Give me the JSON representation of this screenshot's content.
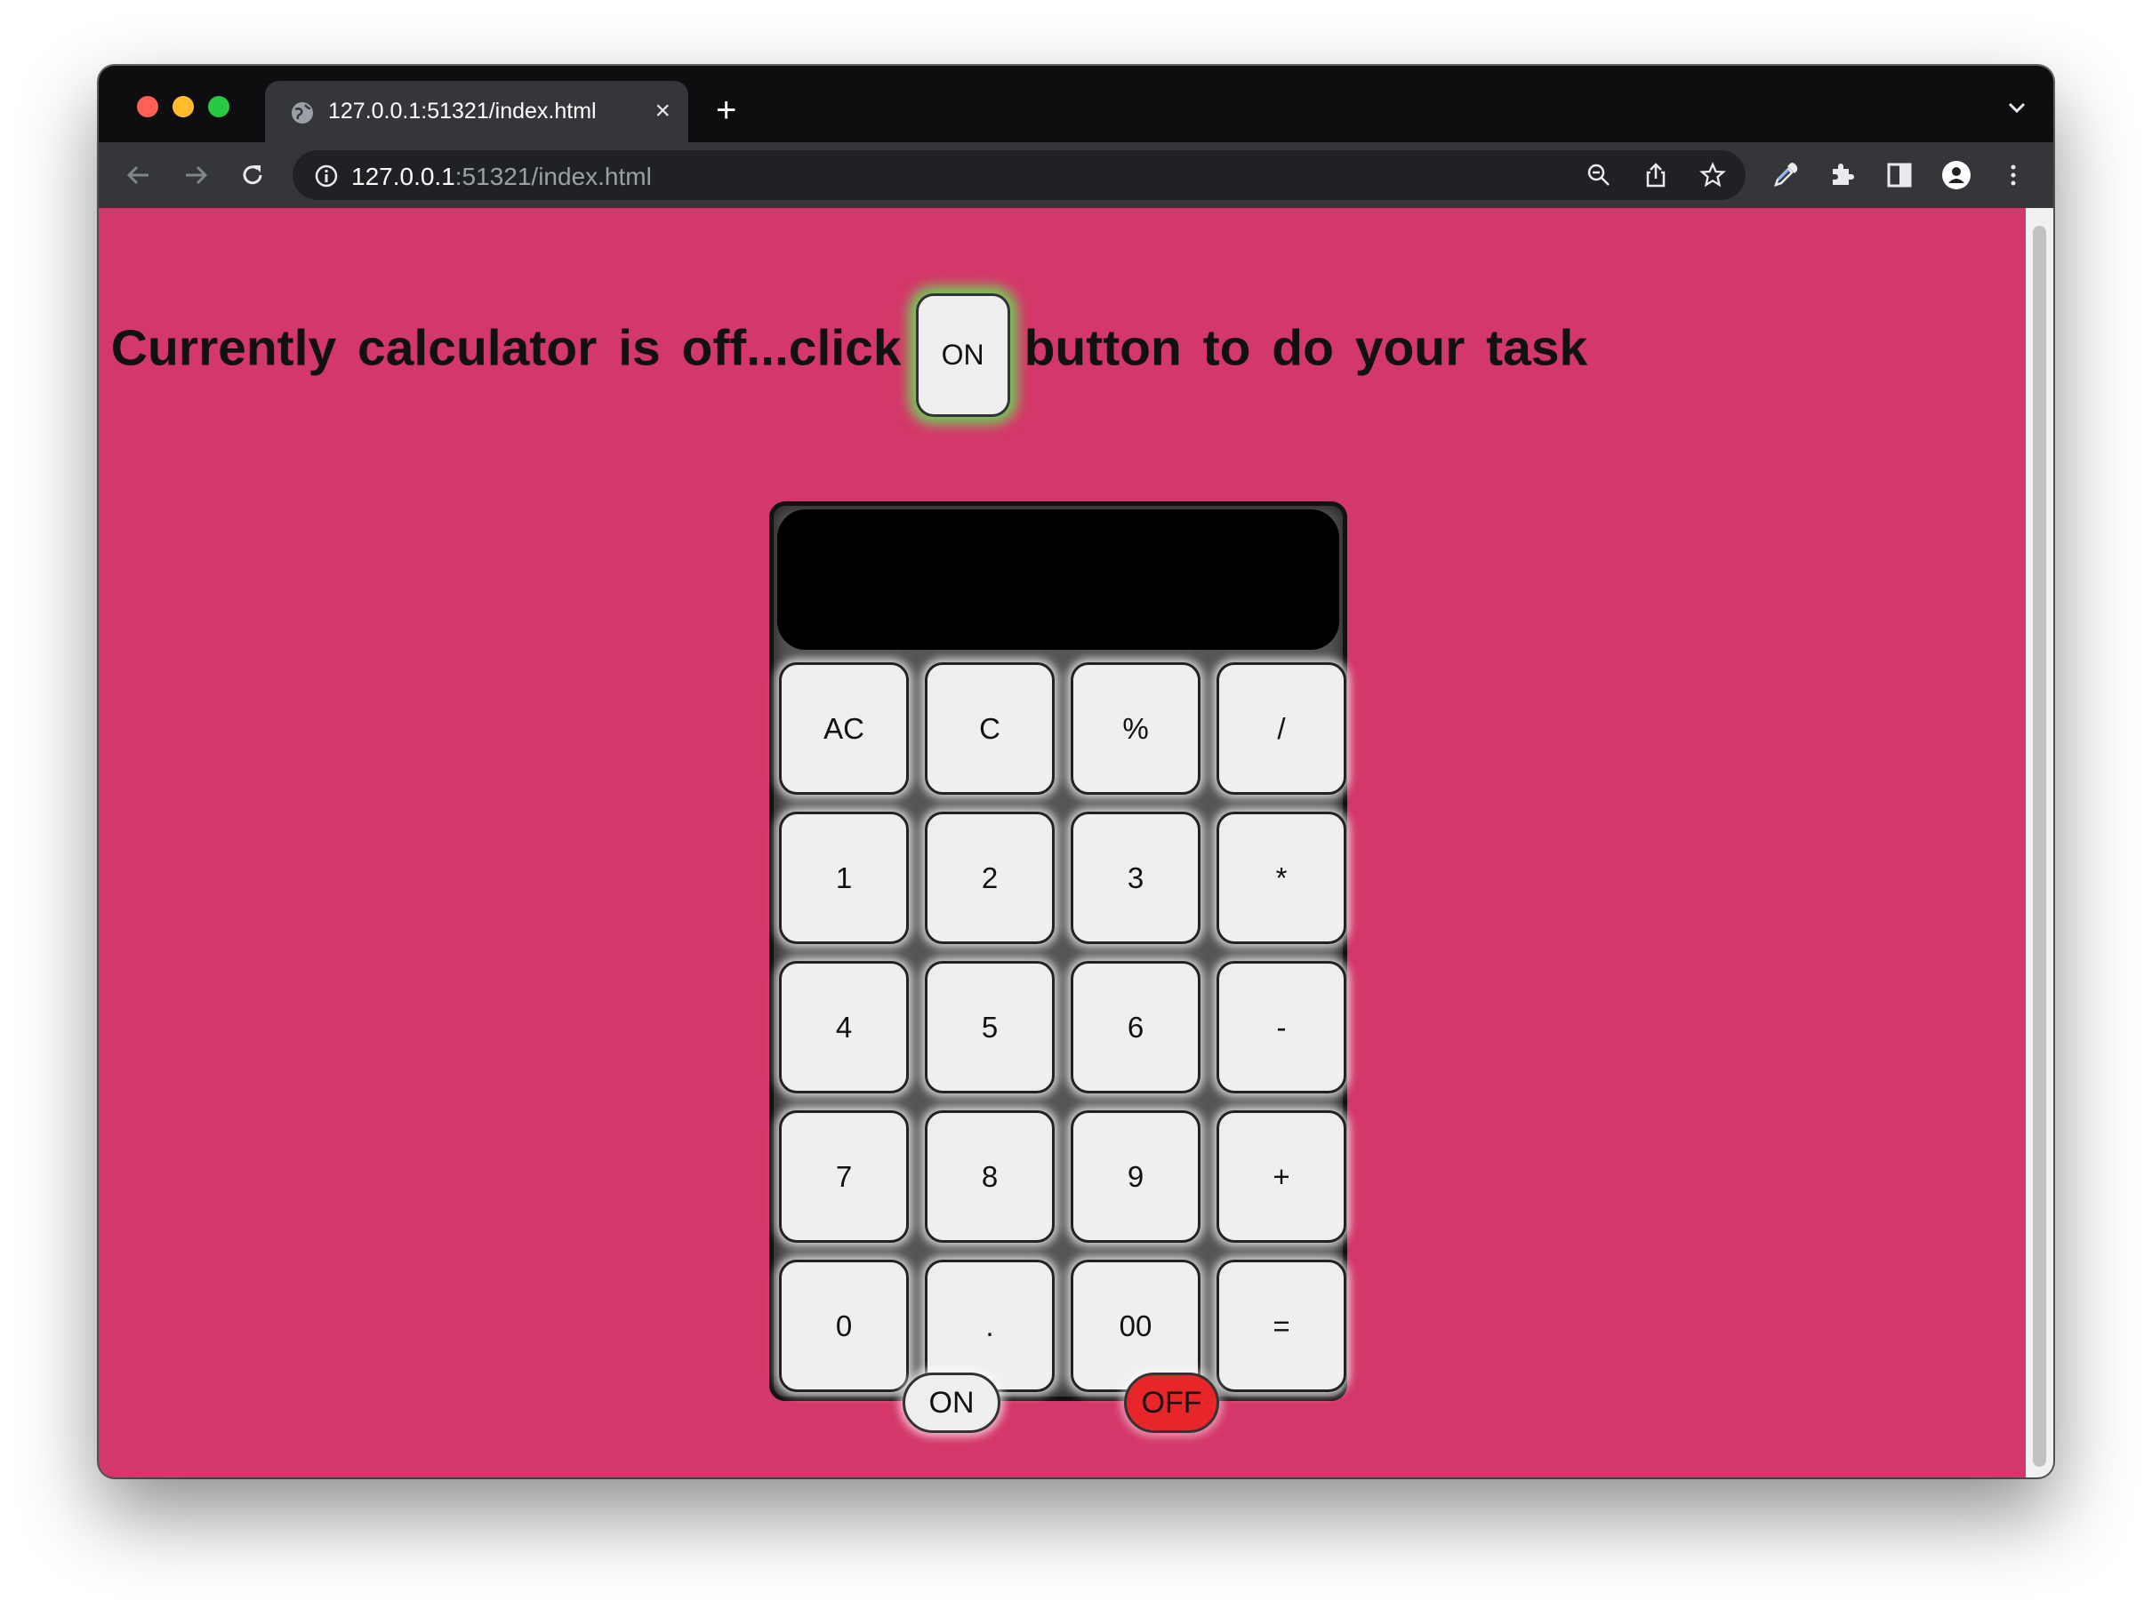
{
  "browser": {
    "tab_title": "127.0.0.1:51321/index.html",
    "tab_close_symbol": "×",
    "new_tab_symbol": "+",
    "url_host": "127.0.0.1",
    "url_path": ":51321/index.html",
    "icons": [
      "back-icon",
      "forward-icon",
      "reload-icon",
      "info-icon",
      "zoom-icon",
      "share-icon",
      "star-icon",
      "eyedropper-icon",
      "extensions-icon",
      "sidebar-icon",
      "profile-icon",
      "menu-icon"
    ]
  },
  "page": {
    "headline_before": "Currently calculator is off...click",
    "headline_button": "ON",
    "headline_after": "button to do your task",
    "background_color": "#d43769"
  },
  "calculator": {
    "display_value": "",
    "keys": [
      "AC",
      "C",
      "%",
      "/",
      "1",
      "2",
      "3",
      "*",
      "4",
      "5",
      "6",
      "-",
      "7",
      "8",
      "9",
      "+",
      "0",
      ".",
      "00",
      "="
    ],
    "on_label": "ON",
    "off_label": "OFF",
    "off_color": "#e8262a"
  }
}
